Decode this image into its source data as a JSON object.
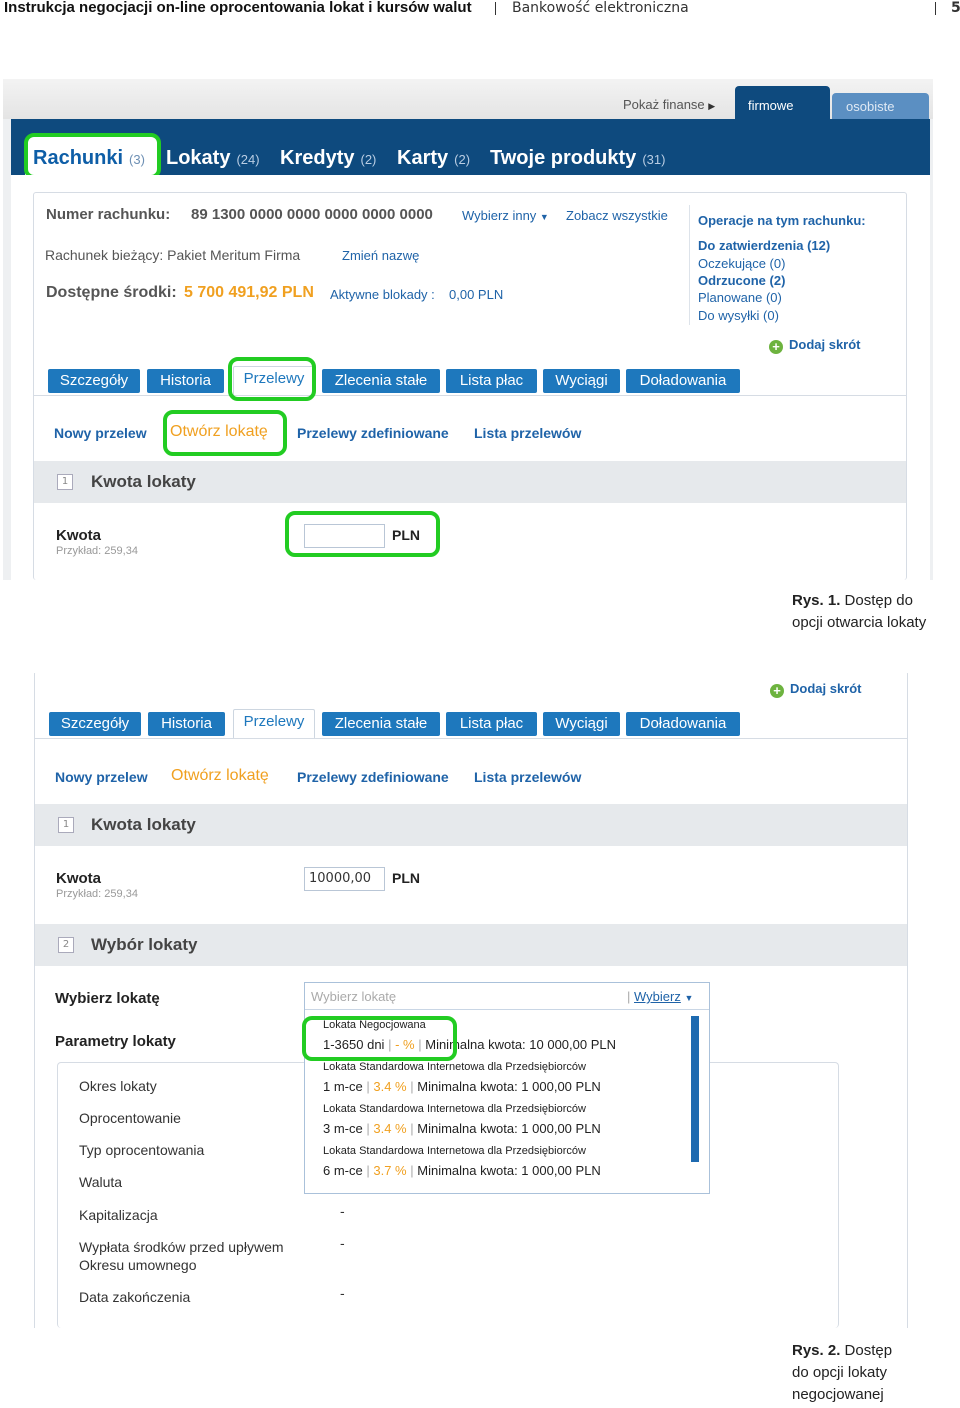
{
  "header": {
    "title": "Instrukcja negocjacji on-line oprocentowania lokat i kursów walut",
    "section": "Bankowość elektroniczna",
    "page_number": "5"
  },
  "fig1": {
    "top": {
      "show_finance": "Pokaż finanse",
      "tab_company": "firmowe",
      "tab_personal": "osobiste"
    },
    "main_tabs": [
      {
        "label": "Rachunki",
        "count": "(3)"
      },
      {
        "label": "Lokaty",
        "count": "(24)"
      },
      {
        "label": "Kredyty",
        "count": "(2)"
      },
      {
        "label": "Karty",
        "count": "(2)"
      },
      {
        "label": "Twoje produkty",
        "count": "(31)"
      }
    ],
    "account": {
      "number_label": "Numer rachunku:",
      "number": "89 1300 0000 0000 0000 0000 0000",
      "choose_other": "Wybierz inny",
      "see_all": "Zobacz wszystkie",
      "name": "Rachunek bieżący: Pakiet Meritum Firma",
      "rename": "Zmień nazwę",
      "funds_label": "Dostępne środki:",
      "funds": "5 700 491,92 PLN",
      "blocks_label": "Aktywne blokady :",
      "blocks": "0,00 PLN"
    },
    "operations": {
      "title": "Operacje na tym rachunku:",
      "items": [
        "Do zatwierdzenia (12)",
        "Oczekujące (0)",
        "Odrzucone (2)",
        "Planowane (0)",
        "Do wysyłki (0)"
      ]
    },
    "add_shortcut": "Dodaj skrót",
    "action_tabs": [
      "Szczegóły",
      "Historia",
      "Przelewy",
      "Zlecenia stałe",
      "Lista płac",
      "Wyciągi",
      "Doładowania"
    ],
    "sub_links": [
      "Nowy przelew",
      "Otwórz lokatę",
      "Przelewy zdefiniowane",
      "Lista przelewów"
    ],
    "step1": {
      "num": "1",
      "title": "Kwota lokaty"
    },
    "amount": {
      "label": "Kwota",
      "hint": "Przykład: 259,34",
      "value": "",
      "currency": "PLN"
    },
    "caption_bold": "Rys. 1.",
    "caption_text": "Dostęp do opcji otwarcia lokaty"
  },
  "fig2": {
    "add_shortcut": "Dodaj skrót",
    "action_tabs": [
      "Szczegóły",
      "Historia",
      "Przelewy",
      "Zlecenia stałe",
      "Lista płac",
      "Wyciągi",
      "Doładowania"
    ],
    "sub_links": [
      "Nowy przelew",
      "Otwórz lokatę",
      "Przelewy zdefiniowane",
      "Lista przelewów"
    ],
    "step1": {
      "num": "1",
      "title": "Kwota lokaty"
    },
    "amount": {
      "label": "Kwota",
      "hint": "Przykład: 259,34",
      "value": "10000,00",
      "currency": "PLN"
    },
    "step2": {
      "num": "2",
      "title": "Wybór lokaty"
    },
    "choose_label": "Wybierz lokatę",
    "params_label": "Parametry lokaty",
    "select": {
      "placeholder": "Wybierz lokatę",
      "button": "Wybierz"
    },
    "options": [
      {
        "name": "Lokata Negocjowana",
        "term": "1-3650 dni",
        "rate": "- %",
        "min": "Minimalna kwota: 10 000,00 PLN"
      },
      {
        "name": "Lokata Standardowa Internetowa dla Przedsiębiorców",
        "term": "1 m-ce",
        "rate": "3.4 %",
        "min": "Minimalna kwota: 1 000,00 PLN"
      },
      {
        "name": "Lokata Standardowa Internetowa dla Przedsiębiorców",
        "term": "3 m-ce",
        "rate": "3.4 %",
        "min": "Minimalna kwota: 1 000,00 PLN"
      },
      {
        "name": "Lokata Standardowa Internetowa dla Przedsiębiorców",
        "term": "6 m-ce",
        "rate": "3.7 %",
        "min": "Minimalna kwota: 1 000,00 PLN"
      }
    ],
    "params": [
      {
        "label": "Okres lokaty",
        "value": ""
      },
      {
        "label": "Oprocentowanie",
        "value": ""
      },
      {
        "label": "Typ oprocentowania",
        "value": ""
      },
      {
        "label": "Waluta",
        "value": ""
      },
      {
        "label": "Kapitalizacja",
        "value": "-"
      },
      {
        "label": "Wypłata środków przed upływem",
        "label2": "Okresu umownego",
        "value": "-"
      },
      {
        "label": "Data zakończenia",
        "value": "-"
      }
    ],
    "caption_bold": "Rys. 2.",
    "caption_line1": "Dostęp",
    "caption_line2": "do opcji lokaty",
    "caption_line3": "negocjowanej"
  }
}
